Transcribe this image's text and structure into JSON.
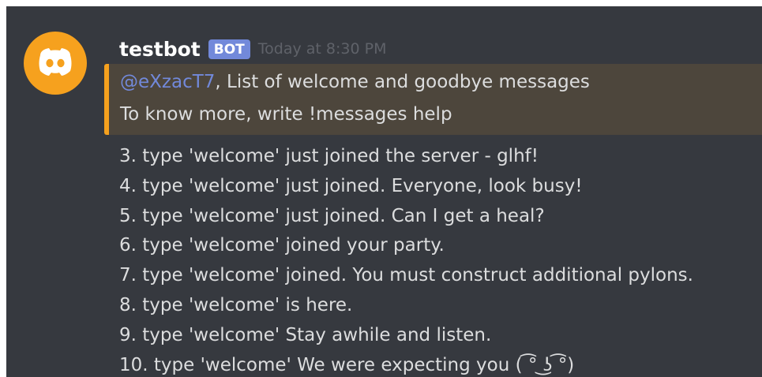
{
  "message": {
    "username": "testbot",
    "bot_tag": "BOT",
    "timestamp": "Today at 8:30 PM",
    "avatar_icon": "discord-logo-icon",
    "colors": {
      "background": "#36393f",
      "avatar": "#f6a11e",
      "embed_border": "#f6a11e",
      "embed_background": "#4d463c",
      "bot_tag": "#7289da",
      "mention": "#7289da",
      "text": "#dcddde"
    },
    "embed": {
      "mention": "@eXzacT7",
      "line1_rest": ", List of welcome and goodbye messages",
      "line2": "To know more, write !messages help"
    },
    "lines": [
      "3. type 'welcome' just joined the server - glhf!",
      "4. type 'welcome' just joined. Everyone, look busy!",
      "5. type 'welcome' just joined. Can I get a heal?",
      "6. type 'welcome' joined your party.",
      "7. type 'welcome' joined. You must construct additional pylons.",
      "8. type 'welcome' is here.",
      "9. type 'welcome' Stay awhile and listen.",
      "10. type 'welcome' We were expecting you ( ͡° ͜ʖ ͡°)"
    ]
  }
}
